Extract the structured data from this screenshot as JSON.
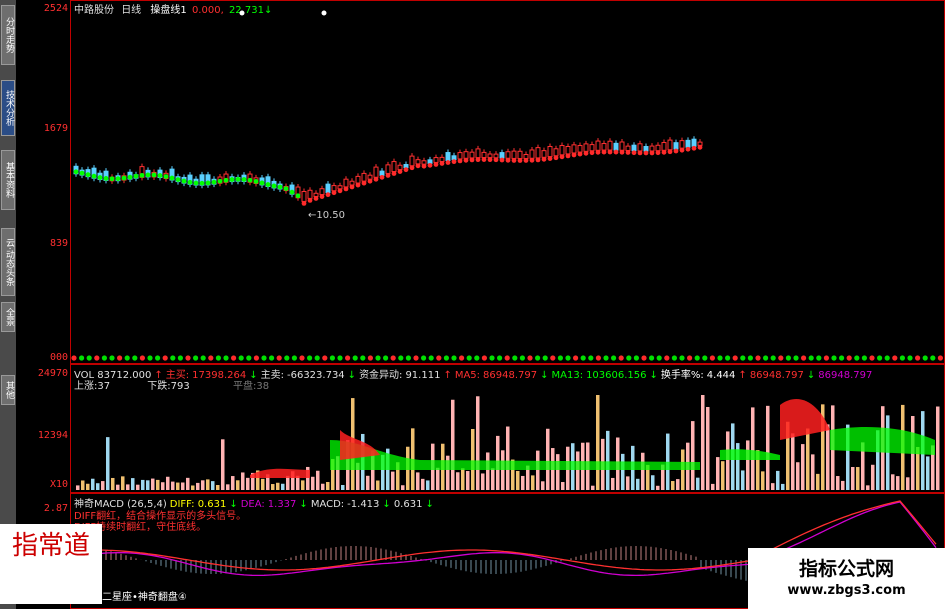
{
  "sidebar": {
    "tabs": [
      {
        "label": "分时走势",
        "active": false
      },
      {
        "label": "技术分析",
        "active": true
      },
      {
        "label": "基本资料",
        "active": false
      },
      {
        "label": "云·动态头条",
        "active": false
      },
      {
        "label": "全景",
        "active": false
      },
      {
        "label": "其他",
        "active": false
      }
    ]
  },
  "main": {
    "stock_name": "中路股份",
    "period": "日线",
    "indicator": "操盘线1",
    "val1": "0.000,",
    "val2": "22.731",
    "axis": [
      "2524",
      "1679",
      "839",
      "000"
    ],
    "low_marker": "10.50"
  },
  "volume": {
    "line1": [
      {
        "text": "VOL 83712.000",
        "color": "#e0e0e0"
      },
      {
        "text": "↑",
        "color": "#ff3030"
      },
      {
        "text": "主买:",
        "color": "#ff3030"
      },
      {
        "text": "17398.264",
        "color": "#ff3030"
      },
      {
        "text": "↓",
        "color": "#00ff00"
      },
      {
        "text": "主卖:",
        "color": "#e0e0e0"
      },
      {
        "text": "-66323.734",
        "color": "#e0e0e0"
      },
      {
        "text": "↓",
        "color": "#00ff00"
      },
      {
        "text": "资金异动:",
        "color": "#e0e0e0"
      },
      {
        "text": "91.111",
        "color": "#e0e0e0"
      },
      {
        "text": "↑",
        "color": "#ff3030"
      },
      {
        "text": "MA5:",
        "color": "#ff3030"
      },
      {
        "text": "86948.797",
        "color": "#ff3030"
      },
      {
        "text": "↓",
        "color": "#00ff00"
      },
      {
        "text": "MA13:",
        "color": "#00ff00"
      },
      {
        "text": "103606.156",
        "color": "#00ff00"
      },
      {
        "text": "↓",
        "color": "#00ff00"
      },
      {
        "text": "换手率%:",
        "color": "#ffffff"
      },
      {
        "text": "4.444",
        "color": "#ffffff"
      },
      {
        "text": "↑",
        "color": "#ff3030"
      },
      {
        "text": "86948.797",
        "color": "#ff3030"
      },
      {
        "text": "↓",
        "color": "#00ff00"
      },
      {
        "text": "86948.797",
        "color": "#d000d0"
      }
    ],
    "up_label": "上涨:",
    "up_count": "37",
    "down_label": "下跌:",
    "down_count": "793",
    "flat_label": "平盘:",
    "flat_count": "38",
    "axis": [
      "24970",
      "12394",
      "X10"
    ]
  },
  "macd": {
    "line1": [
      {
        "text": "神奇MACD (26,5,4)",
        "color": "#e0e0e0"
      },
      {
        "text": "DIFF: 0.631",
        "color": "#ffff00"
      },
      {
        "text": "↓",
        "color": "#00ff00"
      },
      {
        "text": "DEA:",
        "color": "#d000d0"
      },
      {
        "text": "1.337",
        "color": "#d000d0"
      },
      {
        "text": "↓",
        "color": "#00ff00"
      },
      {
        "text": "MACD:",
        "color": "#e0e0e0"
      },
      {
        "text": "-1.413",
        "color": "#e0e0e0"
      },
      {
        "text": "↓",
        "color": "#00ff00"
      },
      {
        "text": "0.631",
        "color": "#e0e0e0"
      },
      {
        "text": "↓",
        "color": "#00ff00"
      }
    ],
    "note1": "DIFF翻红，结合操作显示的多头信号。",
    "note2": "DIFF持续时翻红，守住底线。",
    "footer": "二星座•神奇翻盘④",
    "axis": [
      "2.87"
    ]
  },
  "watermark": {
    "logo_text": "指常道",
    "site_title": "指标公式网",
    "site_url": "www.zbgs3.com"
  },
  "colors": {
    "frame": "#c00000",
    "axis_text": "#ff3030",
    "up": "#ff2a2a",
    "down": "#00e000",
    "candle_up": "#ff3030",
    "candle_down": "#5ad0ff",
    "diff_line": "#ff3030",
    "dea_line": "#d000d0",
    "ma_green": "#00ff00"
  }
}
